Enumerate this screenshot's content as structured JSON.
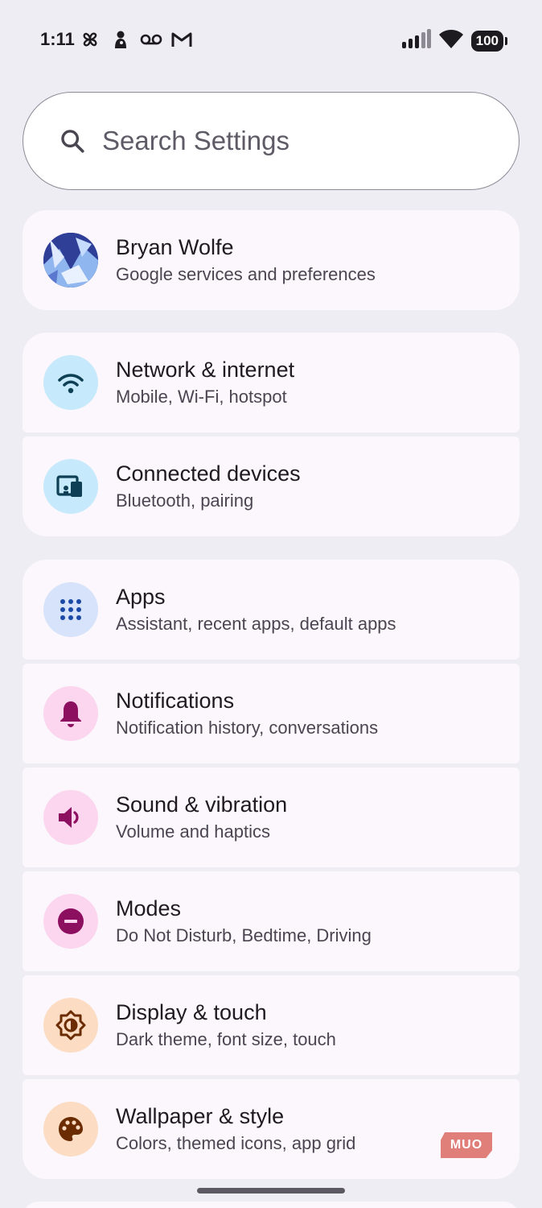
{
  "status": {
    "time": "1:11",
    "battery": "100",
    "icons_left": [
      "pinwheel-icon",
      "doll-icon",
      "voicemail-icon",
      "gmail-icon"
    ],
    "icons_right": [
      "signal-icon",
      "wifi-icon",
      "battery-icon"
    ]
  },
  "search": {
    "placeholder": "Search Settings"
  },
  "account": {
    "name": "Bryan Wolfe",
    "subtitle": "Google services and preferences"
  },
  "items": [
    {
      "title": "Network & internet",
      "subtitle": "Mobile, Wi-Fi, hotspot",
      "icon": "wifi-icon",
      "icon_bg": "#c6e9fb",
      "icon_color": "#0e3f55"
    },
    {
      "title": "Connected devices",
      "subtitle": "Bluetooth, pairing",
      "icon": "devices-icon",
      "icon_bg": "#c6e9fb",
      "icon_color": "#0e3f55"
    },
    {
      "title": "Apps",
      "subtitle": "Assistant, recent apps, default apps",
      "icon": "apps-grid-icon",
      "icon_bg": "#d7e3fb",
      "icon_color": "#1a4aa6"
    },
    {
      "title": "Notifications",
      "subtitle": "Notification history, conversations",
      "icon": "bell-icon",
      "icon_bg": "#fbd6ee",
      "icon_color": "#8d0f5f"
    },
    {
      "title": "Sound & vibration",
      "subtitle": "Volume and haptics",
      "icon": "speaker-icon",
      "icon_bg": "#fbd6ee",
      "icon_color": "#8d0f5f"
    },
    {
      "title": "Modes",
      "subtitle": "Do Not Disturb, Bedtime, Driving",
      "icon": "do-not-disturb-icon",
      "icon_bg": "#fbd6ee",
      "icon_color": "#8d0f5f"
    },
    {
      "title": "Display & touch",
      "subtitle": "Dark theme, font size, touch",
      "icon": "brightness-icon",
      "icon_bg": "#fcdcc2",
      "icon_color": "#6a2c00"
    },
    {
      "title": "Wallpaper & style",
      "subtitle": "Colors, themed icons, app grid",
      "icon": "palette-icon",
      "icon_bg": "#fcdcc2",
      "icon_color": "#6a2c00"
    }
  ],
  "watermark": "MUO"
}
